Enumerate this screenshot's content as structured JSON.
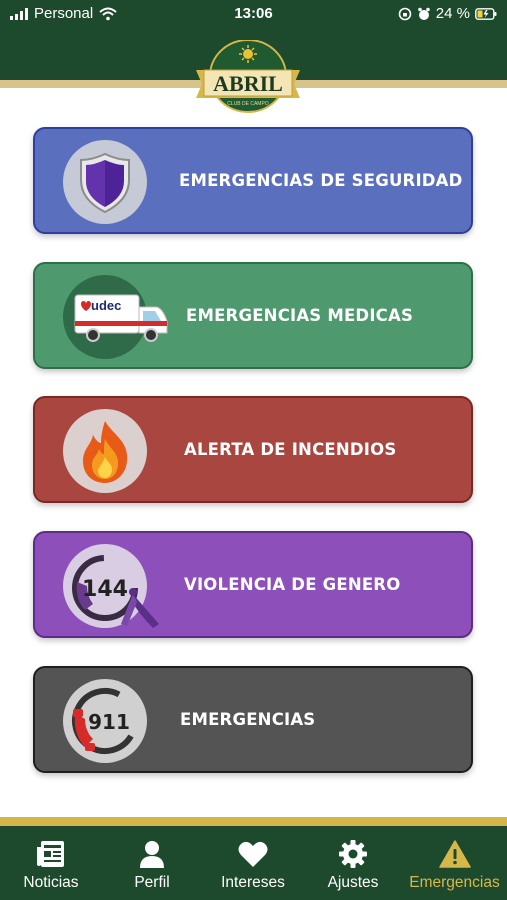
{
  "status_bar": {
    "carrier": "Personal",
    "time": "13:06",
    "battery": "24 %"
  },
  "header": {
    "logo_text": "ABRIL",
    "logo_subtext": "CLUB DE CAMPO"
  },
  "cards": [
    {
      "label": "EMERGENCIAS DE SEGURIDAD",
      "icon": "shield-icon",
      "color": "#5b6fbf"
    },
    {
      "label": "EMERGENCIAS MEDICAS",
      "icon": "ambulance-icon",
      "color": "#4e9a6e",
      "icon_text": "udec"
    },
    {
      "label": "ALERTA DE INCENDIOS",
      "icon": "fire-icon",
      "color": "#a8463f"
    },
    {
      "label": "VIOLENCIA DE GENERO",
      "icon": "phone-144-icon",
      "color": "#8d4fb9",
      "icon_text": "144"
    },
    {
      "label": "EMERGENCIAS",
      "icon": "phone-911-icon",
      "color": "#545454",
      "icon_text": "911"
    }
  ],
  "tabs": [
    {
      "label": "Noticias",
      "icon": "newspaper-icon"
    },
    {
      "label": "Perfil",
      "icon": "person-icon"
    },
    {
      "label": "Intereses",
      "icon": "heart-icon"
    },
    {
      "label": "Ajustes",
      "icon": "gear-icon"
    },
    {
      "label": "Emergencias",
      "icon": "warning-icon",
      "active": true
    }
  ],
  "colors": {
    "header_green": "#1d4a2c",
    "accent_gold": "#d6b84a"
  }
}
